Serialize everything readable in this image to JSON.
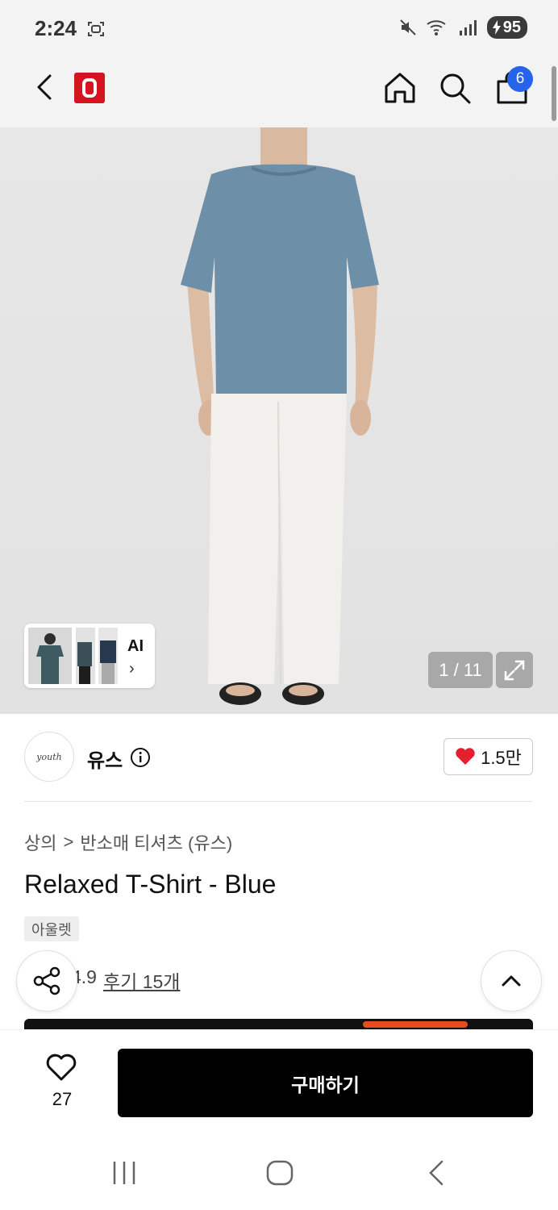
{
  "status_bar": {
    "time": "2:24",
    "battery": "95"
  },
  "header": {
    "logo_letter": "O",
    "cart_count": "6",
    "icons": [
      "back-arrow-icon",
      "home-icon",
      "search-icon",
      "shopping-bag-icon"
    ]
  },
  "gallery": {
    "ai_label": "AI",
    "ai_chevron": "›",
    "counter": "1 / 11"
  },
  "brand": {
    "logo_text": "youth",
    "name": "유스",
    "likes": "1.5만"
  },
  "product": {
    "breadcrumb": [
      "상의",
      "반소매 티셔츠 (유스)"
    ],
    "breadcrumb_separator": ">",
    "title": "Relaxed T-Shirt - Blue",
    "tag": "아울렛",
    "rating": "4.9",
    "review_link": "후기 15개"
  },
  "bottom_bar": {
    "wish_count": "27",
    "buy_label": "구매하기"
  },
  "colors": {
    "accent_red": "#d4141e",
    "badge_blue": "#2563eb",
    "buy_button": "#000000",
    "heart": "#e5202e"
  }
}
